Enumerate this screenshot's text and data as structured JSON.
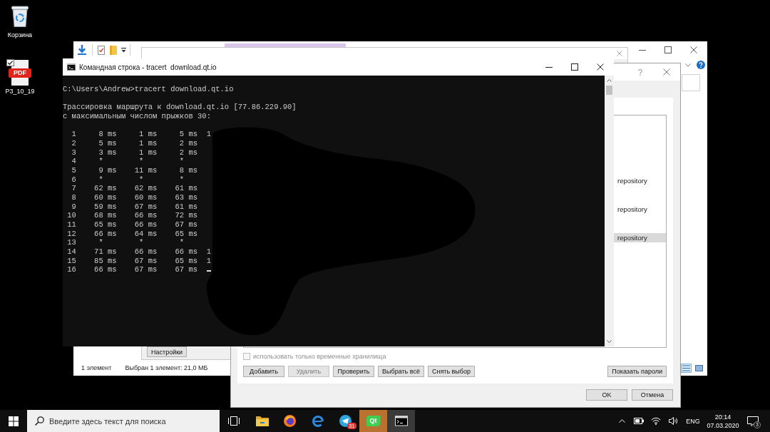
{
  "desktop_icons": [
    {
      "kind": "recycle_bin",
      "label": "Корзина",
      "checked": false
    },
    {
      "kind": "pdf",
      "label": "P3_10_19",
      "icon_text": "PDF",
      "checked": true
    }
  ],
  "explorer_window": {
    "status_bar": {
      "item_count": "1 элемент",
      "selection": "Выбран 1 элемент: 21,0 МБ"
    },
    "view_buttons": [
      {
        "kind": "details",
        "selected": true
      },
      {
        "kind": "large_icons",
        "selected": false
      }
    ]
  },
  "settings_window": {
    "buttons": [
      "Настройки"
    ]
  },
  "repository_dialog": {
    "list_items": [
      {
        "label": "repository",
        "selected": false
      },
      {
        "label": "repository",
        "selected": false
      },
      {
        "label": "repository",
        "selected": true
      }
    ],
    "temporary_only": {
      "label": "использовать только временные хранилища",
      "checked": false,
      "disabled": true
    },
    "buttons": [
      {
        "label": "Добавить",
        "disabled": false
      },
      {
        "label": "Удалить",
        "disabled": true
      },
      {
        "label": "Проверить",
        "disabled": false
      },
      {
        "label": "Выбрать всё",
        "disabled": false
      },
      {
        "label": "Снять выбор",
        "disabled": false
      }
    ],
    "show_passwords_button": {
      "label": "Показать пароли",
      "disabled": false
    },
    "footer_buttons": [
      "OK",
      "Отмена"
    ]
  },
  "console_window": {
    "title": "Командная строка - tracert  download.qt.io",
    "command": "C:\\Users\\Andrew>tracert download.qt.io",
    "header": [
      "Трассировка маршрута к download.qt.io [77.86.229.90]",
      "с максимальным числом прыжков 30:"
    ],
    "hops": [
      "  1     8 ms     1 ms     5 ms  1",
      "  2     5 ms     1 ms     2 ms",
      "  3     3 ms     1 ms     2 ms",
      "  4     *        *        *",
      "  5     9 ms    11 ms     8 ms",
      "  6     *        *        *",
      "  7    62 ms    62 ms    61 ms",
      "  8    60 ms    60 ms    63 ms",
      "  9    59 ms    67 ms    61 ms",
      " 10    68 ms    66 ms    72 ms",
      " 11    65 ms    66 ms    67 ms",
      " 12    66 ms    64 ms    65 ms",
      " 13     *        *        *",
      " 14    71 ms    66 ms    66 ms  1",
      " 15    85 ms    67 ms    65 ms  1",
      " 16    66 ms    67 ms    67 ms"
    ],
    "cursor": true
  },
  "taskbar": {
    "search": {
      "placeholder": "Введите здесь текст для поиска"
    },
    "apps": [
      {
        "kind": "file_explorer",
        "active": false,
        "attention": false
      },
      {
        "kind": "firefox",
        "active": false,
        "attention": false
      },
      {
        "kind": "edge",
        "active": false,
        "attention": false
      },
      {
        "kind": "telegram",
        "badge": "31",
        "active": false,
        "attention": false
      },
      {
        "kind": "qt",
        "label": "Qt",
        "active": false,
        "attention": true
      },
      {
        "kind": "console",
        "active": true,
        "attention": false
      }
    ],
    "language": "ENG",
    "time": "20:14",
    "date": "07.03.2020",
    "notification_count": "3"
  }
}
